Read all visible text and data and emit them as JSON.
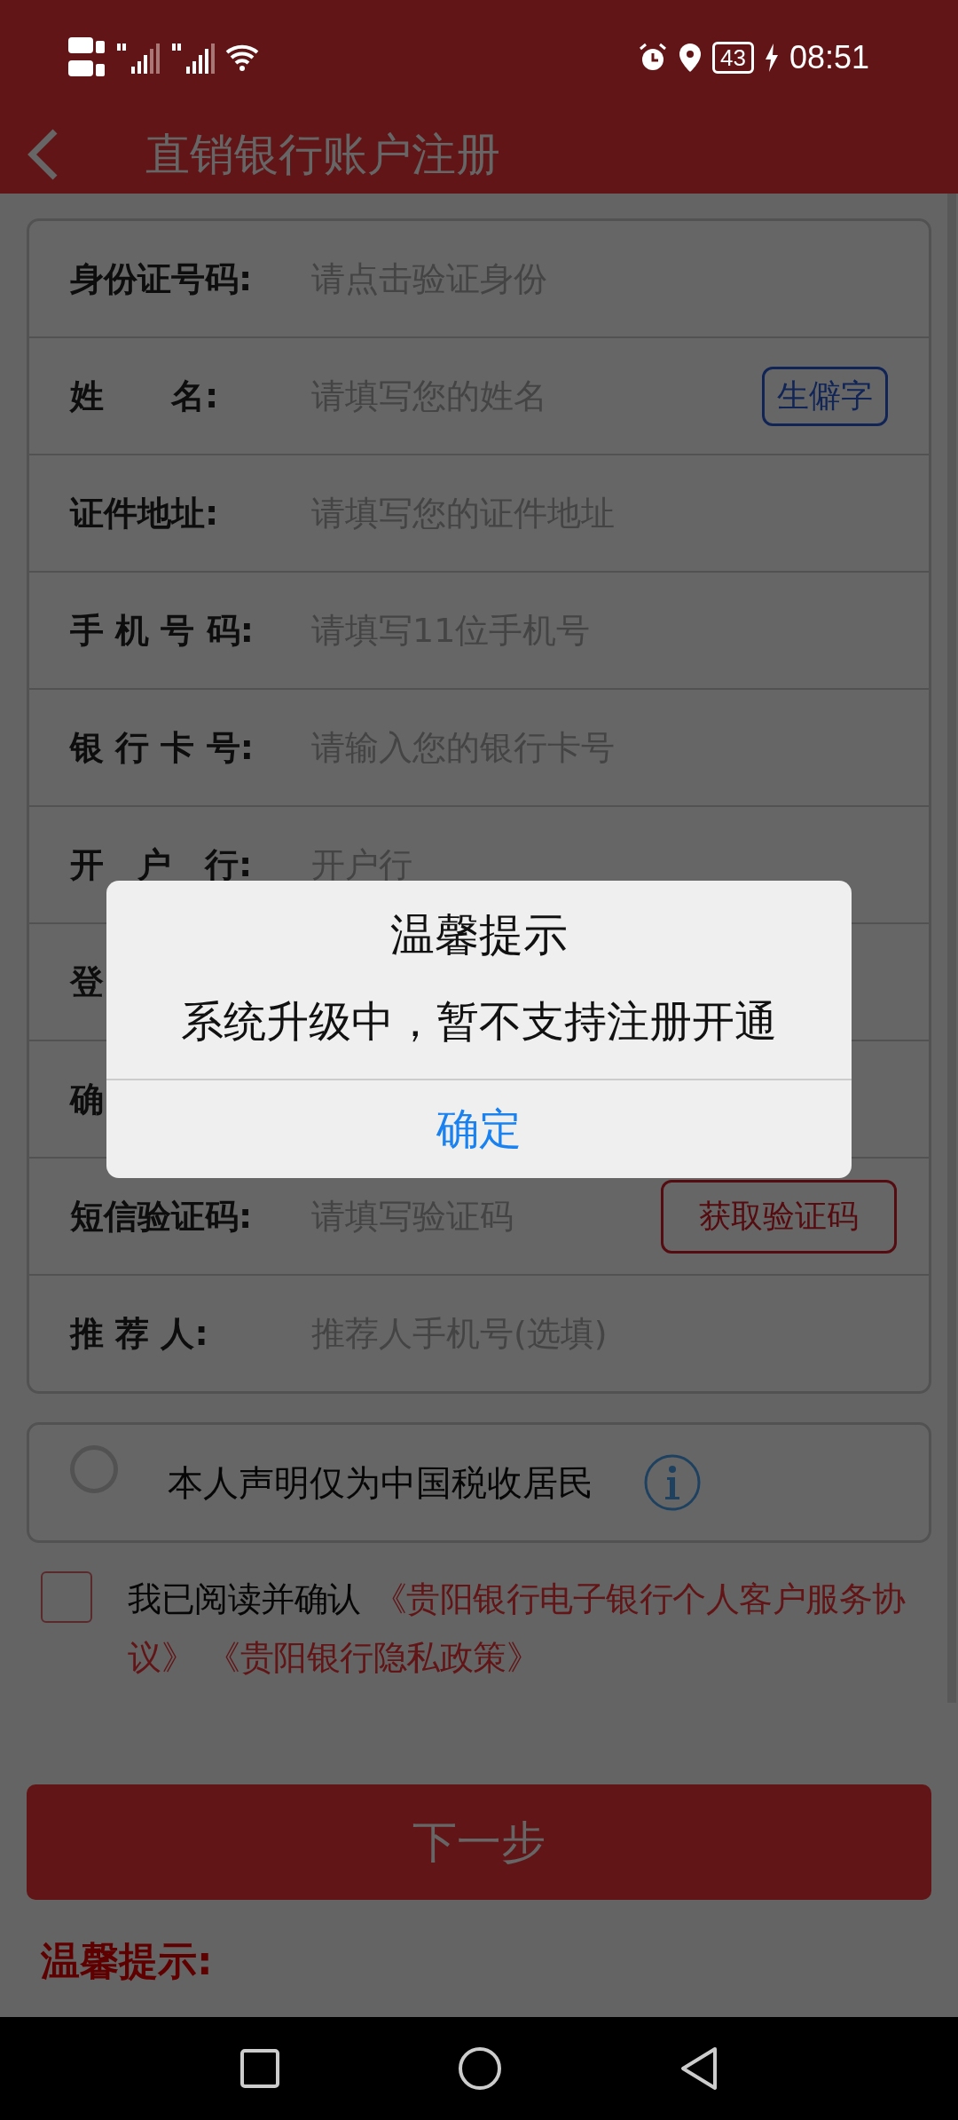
{
  "status_bar": {
    "battery": "43",
    "time": "08:51"
  },
  "header": {
    "title": "直销银行账户注册"
  },
  "form": {
    "rows": [
      {
        "label": "身份证号码:",
        "placeholder": "请点击验证身份"
      },
      {
        "label": "姓　　名:",
        "placeholder": "请填写您的姓名",
        "button": {
          "text": "生僻字",
          "kind": "rare"
        }
      },
      {
        "label": "证件地址:",
        "placeholder": "请填写您的证件地址"
      },
      {
        "label": "手 机 号 码:",
        "placeholder": "请填写11位手机号"
      },
      {
        "label": "银 行 卡 号:",
        "placeholder": "请输入您的银行卡号"
      },
      {
        "label": "开　户　行:",
        "placeholder": "开户行"
      },
      {
        "label": "登"
      },
      {
        "label": "确"
      },
      {
        "label": "短信验证码:",
        "placeholder": "请填写验证码",
        "button": {
          "text": "获取验证码",
          "kind": "code"
        }
      },
      {
        "label": "推 荐 人:",
        "placeholder": "推荐人手机号(选填)"
      }
    ]
  },
  "tax_declaration": {
    "text": "本人声明仅为中国税收居民",
    "checked": false
  },
  "agreement": {
    "checked": false,
    "prefix": "我已阅读并确认",
    "links": [
      "《贵阳银行电子银行个人客户服务协议》",
      "《贵阳银行隐私政策》"
    ]
  },
  "next_button": "下一步",
  "tips_title": "温馨提示:",
  "dialog": {
    "title": "温馨提示",
    "message": "系统升级中，暂不支持注册开通",
    "button": "确定"
  }
}
